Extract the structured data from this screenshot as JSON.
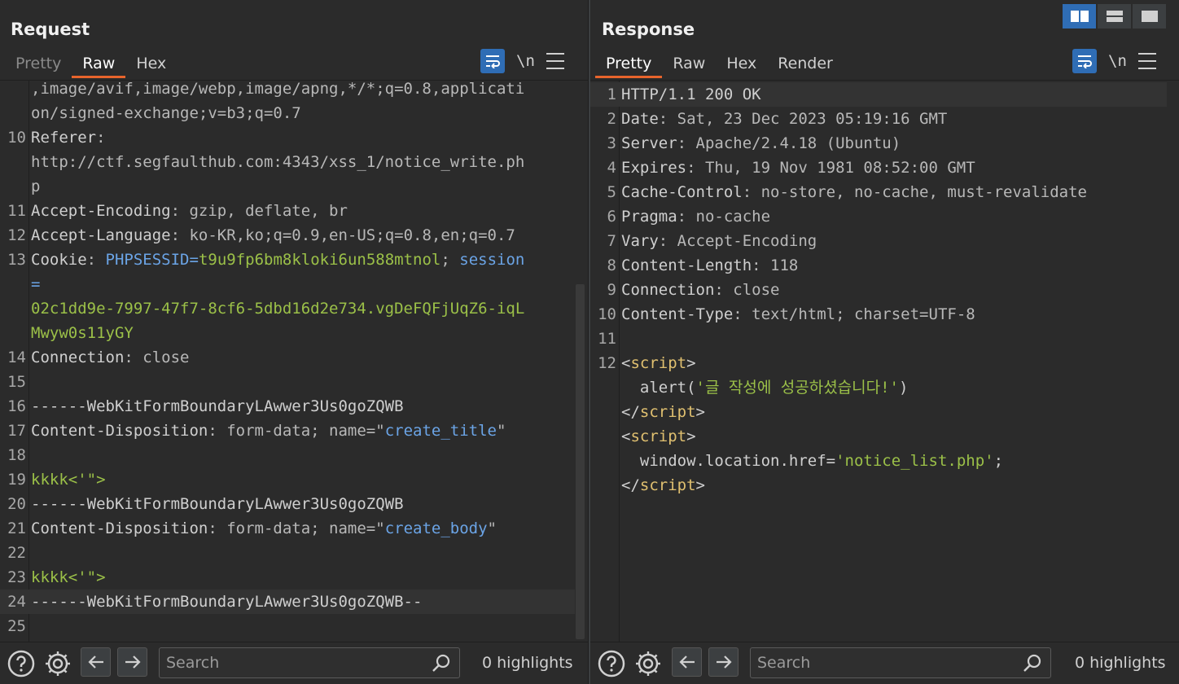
{
  "request": {
    "title": "Request",
    "tabs": [
      "Pretty",
      "Raw",
      "Hex"
    ],
    "lines": [
      {
        "n": "",
        "parts": [
          {
            "t": ",image/avif,image/webp,image/apng,*/*;q=0.8,applicati",
            "c": "val"
          }
        ]
      },
      {
        "n": "",
        "parts": [
          {
            "t": "on/signed-exchange;v=b3;q=0.7",
            "c": "val"
          }
        ]
      },
      {
        "n": "10",
        "parts": [
          {
            "t": "Referer",
            "c": "hdr"
          },
          {
            "t": ":",
            "c": "val"
          }
        ]
      },
      {
        "n": "",
        "parts": [
          {
            "t": "http://ctf.segfaulthub.com:4343/xss_1/notice_write.ph",
            "c": "val"
          }
        ]
      },
      {
        "n": "",
        "parts": [
          {
            "t": "p",
            "c": "val"
          }
        ]
      },
      {
        "n": "11",
        "parts": [
          {
            "t": "Accept-Encoding",
            "c": "hdr"
          },
          {
            "t": ": gzip, deflate, br",
            "c": "val"
          }
        ]
      },
      {
        "n": "12",
        "parts": [
          {
            "t": "Accept-Language",
            "c": "hdr"
          },
          {
            "t": ": ko-KR,ko;q=0.9,en-US;q=0.8,en;q=0.7",
            "c": "val"
          }
        ]
      },
      {
        "n": "13",
        "parts": [
          {
            "t": "Cookie",
            "c": "hdr"
          },
          {
            "t": ": ",
            "c": "val"
          },
          {
            "t": "PHPSESSID",
            "c": "ck"
          },
          {
            "t": "=",
            "c": "ck"
          },
          {
            "t": "t9u9fp6bm8kloki6un588mtnol",
            "c": "cv"
          },
          {
            "t": "; ",
            "c": "val"
          },
          {
            "t": "session",
            "c": "ck"
          }
        ]
      },
      {
        "n": "",
        "parts": [
          {
            "t": "=",
            "c": "ck"
          }
        ]
      },
      {
        "n": "",
        "parts": [
          {
            "t": "02c1dd9e-7997-47f7-8cf6-5dbd16d2e734.vgDeFQFjUqZ6-iqL",
            "c": "cv"
          }
        ]
      },
      {
        "n": "",
        "parts": [
          {
            "t": "Mwyw0s11yGY",
            "c": "cv"
          }
        ]
      },
      {
        "n": "14",
        "parts": [
          {
            "t": "Connection",
            "c": "hdr"
          },
          {
            "t": ": close",
            "c": "val"
          }
        ]
      },
      {
        "n": "15",
        "parts": []
      },
      {
        "n": "16",
        "parts": [
          {
            "t": "------WebKitFormBoundaryLAwwer3Us0goZQWB",
            "c": "hdr"
          }
        ]
      },
      {
        "n": "17",
        "parts": [
          {
            "t": "Content-Disposition",
            "c": "hdr"
          },
          {
            "t": ": form-data; name=\"",
            "c": "val"
          },
          {
            "t": "create_title",
            "c": "ck"
          },
          {
            "t": "\"",
            "c": "val"
          }
        ]
      },
      {
        "n": "18",
        "parts": []
      },
      {
        "n": "19",
        "parts": [
          {
            "t": "kkkk<'\">",
            "c": "str"
          }
        ]
      },
      {
        "n": "20",
        "parts": [
          {
            "t": "------WebKitFormBoundaryLAwwer3Us0goZQWB",
            "c": "hdr"
          }
        ]
      },
      {
        "n": "21",
        "parts": [
          {
            "t": "Content-Disposition",
            "c": "hdr"
          },
          {
            "t": ": form-data; name=\"",
            "c": "val"
          },
          {
            "t": "create_body",
            "c": "ck"
          },
          {
            "t": "\"",
            "c": "val"
          }
        ]
      },
      {
        "n": "22",
        "parts": []
      },
      {
        "n": "23",
        "parts": [
          {
            "t": "kkkk<'\">",
            "c": "str"
          }
        ]
      },
      {
        "n": "24",
        "parts": [
          {
            "t": "------WebKitFormBoundaryLAwwer3Us0goZQWB--",
            "c": "hdr"
          }
        ],
        "hl": true
      },
      {
        "n": "25",
        "parts": []
      }
    ],
    "search_placeholder": "Search",
    "highlights": "0 highlights"
  },
  "response": {
    "title": "Response",
    "tabs": [
      "Pretty",
      "Raw",
      "Hex",
      "Render"
    ],
    "lines": [
      {
        "n": "1",
        "parts": [
          {
            "t": "HTTP/1.1 200 OK",
            "c": "hdr"
          }
        ],
        "hl": true
      },
      {
        "n": "2",
        "parts": [
          {
            "t": "Date",
            "c": "hdr"
          },
          {
            "t": ": Sat, 23 Dec 2023 05:19:16 GMT",
            "c": "val"
          }
        ]
      },
      {
        "n": "3",
        "parts": [
          {
            "t": "Server",
            "c": "hdr"
          },
          {
            "t": ": Apache/2.4.18 (Ubuntu)",
            "c": "val"
          }
        ]
      },
      {
        "n": "4",
        "parts": [
          {
            "t": "Expires",
            "c": "hdr"
          },
          {
            "t": ": Thu, 19 Nov 1981 08:52:00 GMT",
            "c": "val"
          }
        ]
      },
      {
        "n": "5",
        "parts": [
          {
            "t": "Cache-Control",
            "c": "hdr"
          },
          {
            "t": ": no-store, no-cache, must-revalidate",
            "c": "val"
          }
        ]
      },
      {
        "n": "6",
        "parts": [
          {
            "t": "Pragma",
            "c": "hdr"
          },
          {
            "t": ": no-cache",
            "c": "val"
          }
        ]
      },
      {
        "n": "7",
        "parts": [
          {
            "t": "Vary",
            "c": "hdr"
          },
          {
            "t": ": Accept-Encoding",
            "c": "val"
          }
        ]
      },
      {
        "n": "8",
        "parts": [
          {
            "t": "Content-Length",
            "c": "hdr"
          },
          {
            "t": ": 118",
            "c": "val"
          }
        ]
      },
      {
        "n": "9",
        "parts": [
          {
            "t": "Connection",
            "c": "hdr"
          },
          {
            "t": ": close",
            "c": "val"
          }
        ]
      },
      {
        "n": "10",
        "parts": [
          {
            "t": "Content-Type",
            "c": "hdr"
          },
          {
            "t": ": text/html; charset=UTF-8",
            "c": "val"
          }
        ]
      },
      {
        "n": "11",
        "parts": []
      },
      {
        "n": "12",
        "parts": [
          {
            "t": "<",
            "c": "hdr"
          },
          {
            "t": "script",
            "c": "tag"
          },
          {
            "t": ">",
            "c": "hdr"
          }
        ]
      },
      {
        "n": "",
        "parts": [
          {
            "t": "  alert(",
            "c": "hdr"
          },
          {
            "t": "'글 작성에 성공하셨습니다!'",
            "c": "str"
          },
          {
            "t": ")",
            "c": "hdr"
          }
        ]
      },
      {
        "n": "",
        "parts": [
          {
            "t": "</",
            "c": "hdr"
          },
          {
            "t": "script",
            "c": "tag"
          },
          {
            "t": ">",
            "c": "hdr"
          }
        ]
      },
      {
        "n": "",
        "parts": [
          {
            "t": "<",
            "c": "hdr"
          },
          {
            "t": "script",
            "c": "tag"
          },
          {
            "t": ">",
            "c": "hdr"
          }
        ]
      },
      {
        "n": "",
        "parts": [
          {
            "t": "  window.location.href=",
            "c": "hdr"
          },
          {
            "t": "'notice_list.php'",
            "c": "str"
          },
          {
            "t": ";",
            "c": "hdr"
          }
        ]
      },
      {
        "n": "",
        "parts": [
          {
            "t": "</",
            "c": "hdr"
          },
          {
            "t": "script",
            "c": "tag"
          },
          {
            "t": ">",
            "c": "hdr"
          }
        ]
      }
    ],
    "search_placeholder": "Search",
    "highlights": "0 highlights"
  },
  "toolbar": {
    "newline_label": "\\n"
  },
  "colors": {
    "accent": "#e8642c",
    "active_button": "#2f6db5"
  },
  "icons": [
    "help-icon",
    "gear-icon",
    "back-arrow-icon",
    "forward-arrow-icon",
    "search-icon",
    "word-wrap-icon",
    "menu-icon",
    "layout-side-by-side-icon",
    "layout-top-bottom-icon",
    "layout-single-icon"
  ]
}
